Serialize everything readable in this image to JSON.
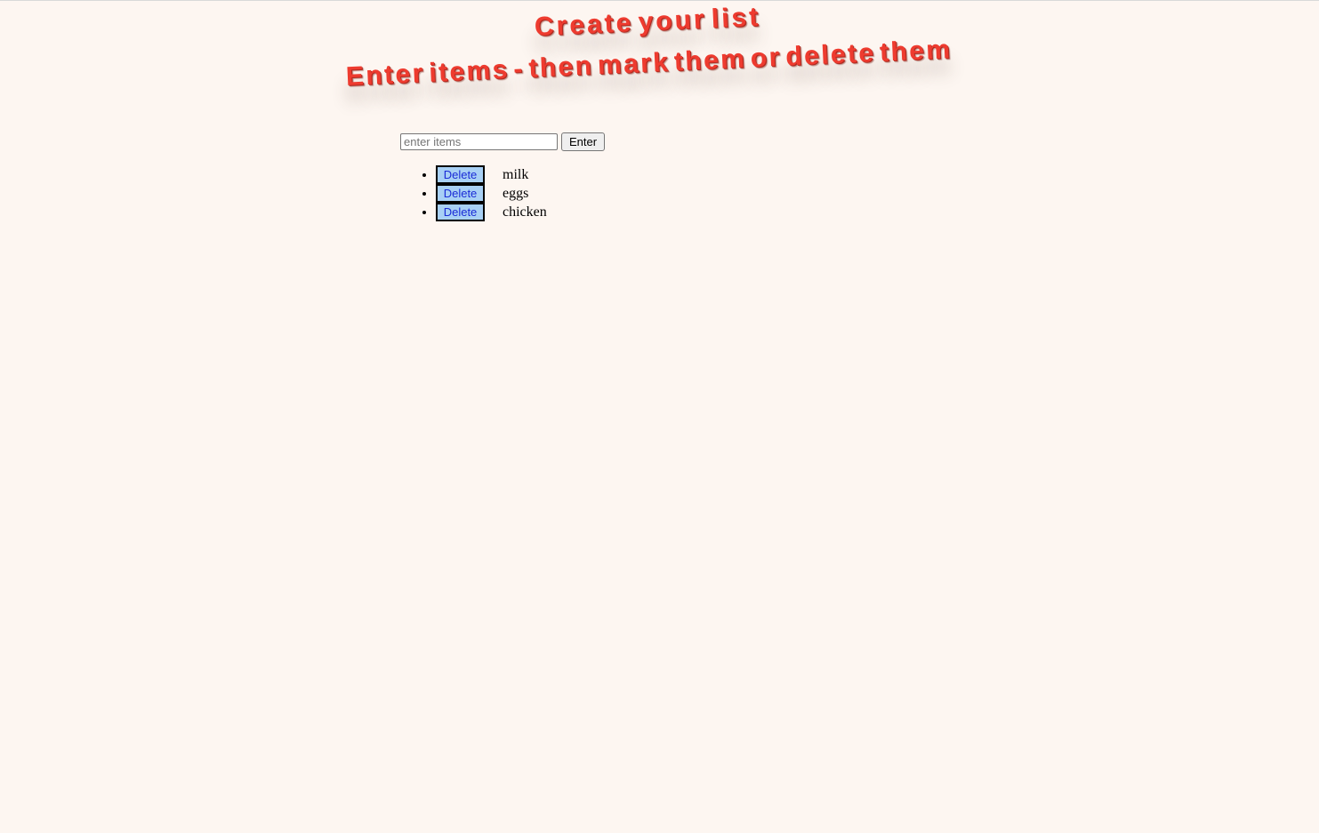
{
  "page": {
    "heading": "Create your list",
    "subheading": "Enter items - then mark them or delete them"
  },
  "entry": {
    "placeholder": "enter items",
    "value": "",
    "button_label": "Enter"
  },
  "items": [
    {
      "delete_label": "Delete",
      "text": "milk"
    },
    {
      "delete_label": "Delete",
      "text": "eggs"
    },
    {
      "delete_label": "Delete",
      "text": "chicken"
    }
  ],
  "colors": {
    "background": "#fdf6f1",
    "heading": "#ee3b2f",
    "delete_button_bg": "#a8d0f5",
    "delete_button_text": "#1a2bd6"
  }
}
